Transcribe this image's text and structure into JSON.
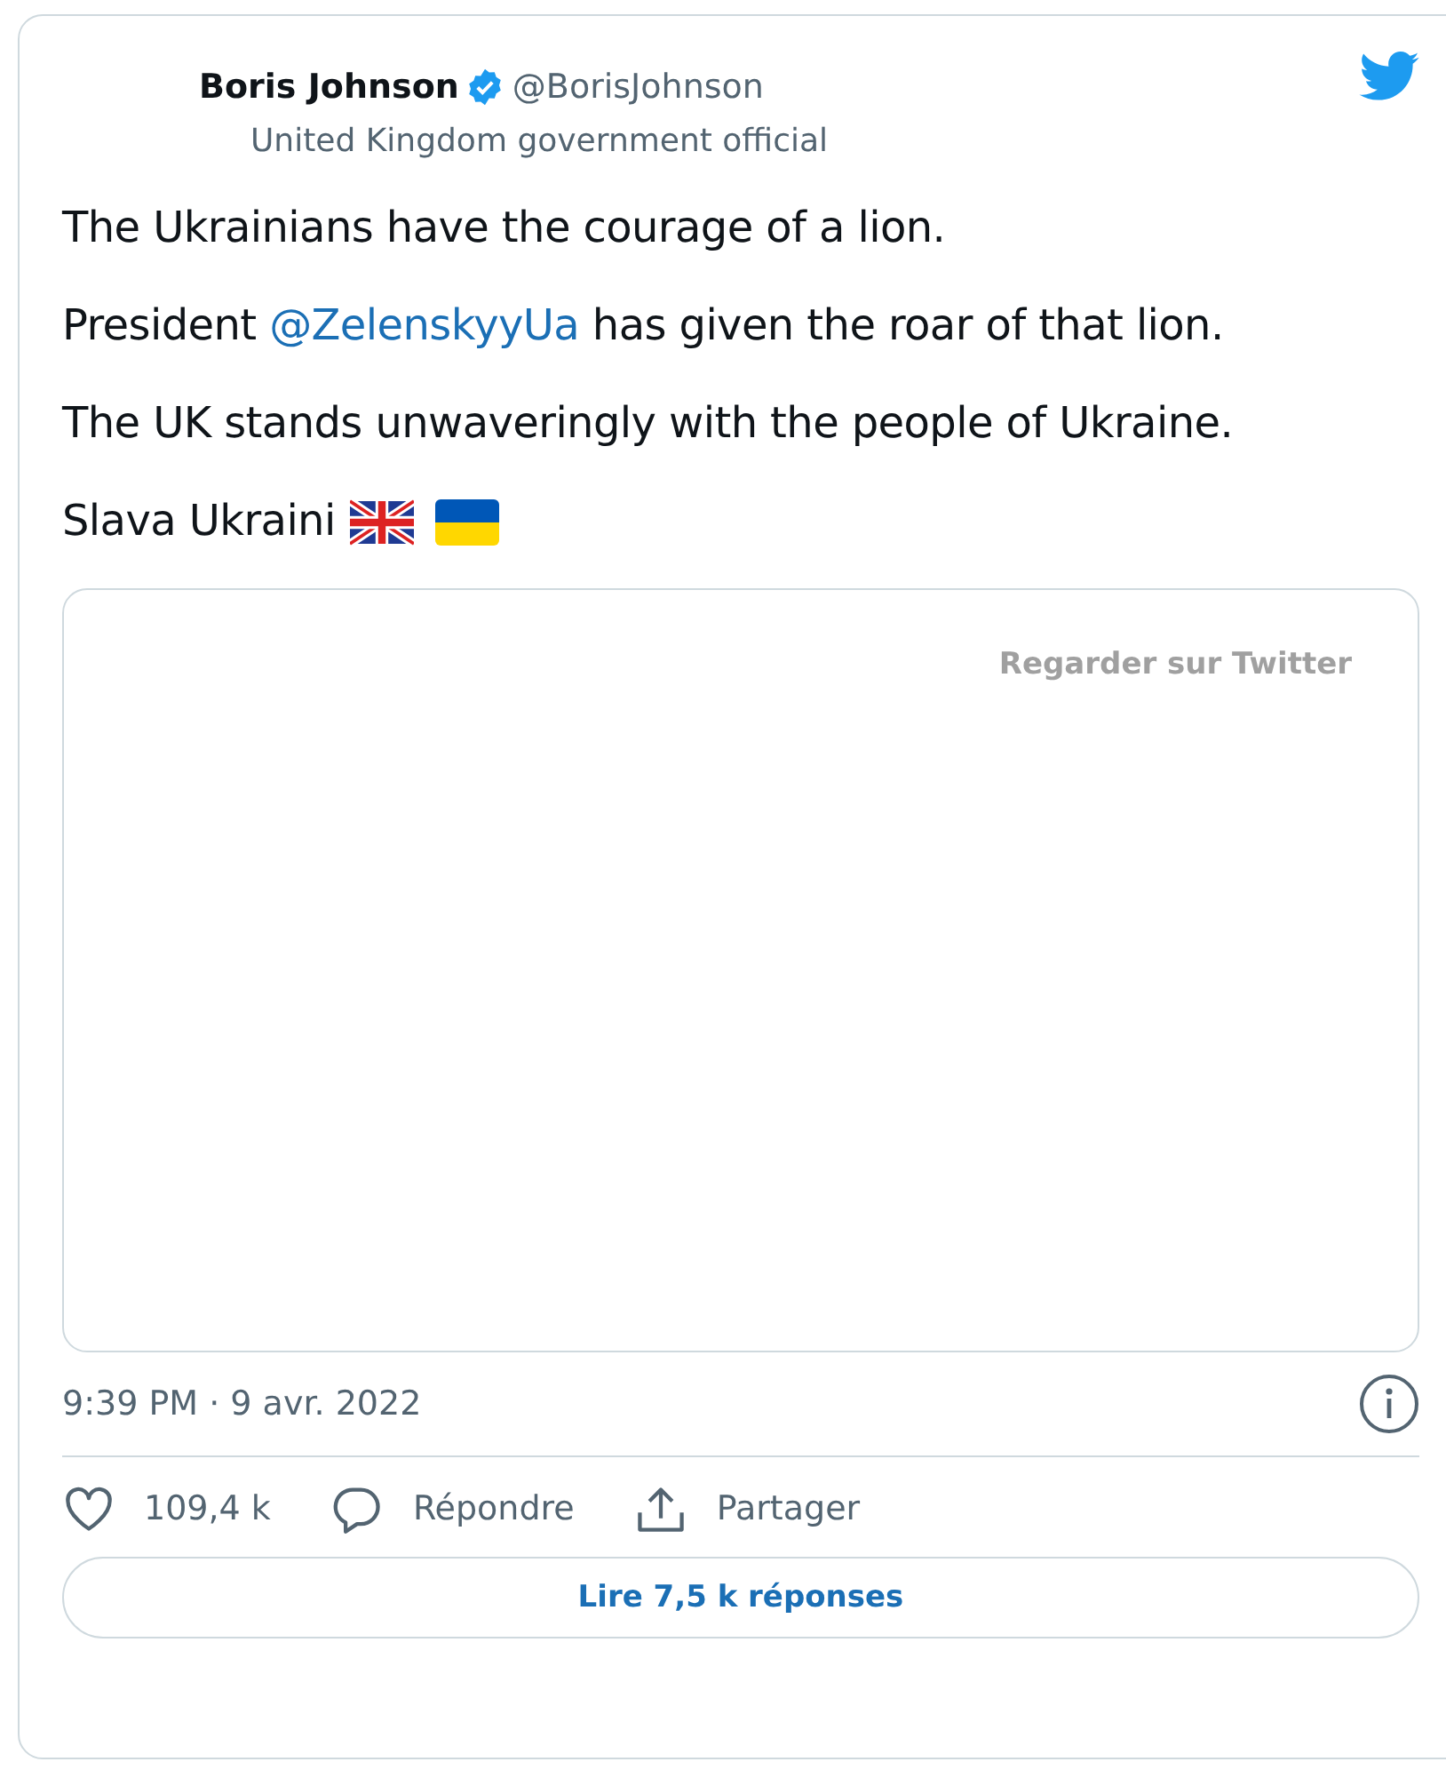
{
  "author": {
    "name": "Boris Johnson",
    "verified": true,
    "handle": "@BorisJohnson",
    "label": "United Kingdom government official"
  },
  "paragraphs": [
    {
      "parts": [
        {
          "kind": "text",
          "text": "The Ukrainians have the courage of a lion."
        }
      ]
    },
    {
      "parts": [
        {
          "kind": "text",
          "text": "President "
        },
        {
          "kind": "mention",
          "text": "@ZelenskyyUa"
        },
        {
          "kind": "text",
          "text": " has given the roar of that lion."
        }
      ]
    },
    {
      "parts": [
        {
          "kind": "text",
          "text": "The UK stands unwaveringly with the people of Ukraine."
        }
      ]
    },
    {
      "parts": [
        {
          "kind": "text",
          "text": "Slava Ukraini"
        },
        {
          "kind": "uk-flag"
        },
        {
          "kind": "ua-flag"
        }
      ]
    }
  ],
  "media": {
    "watch_link": "Regarder sur Twitter"
  },
  "timestamp": "9:39 PM · 9 avr. 2022",
  "actions": [
    {
      "kind": "like",
      "label": "109,4 k"
    },
    {
      "kind": "reply",
      "label": "Répondre"
    },
    {
      "kind": "share",
      "label": "Partager"
    }
  ],
  "read_replies": "Lire 7,5 k réponses"
}
